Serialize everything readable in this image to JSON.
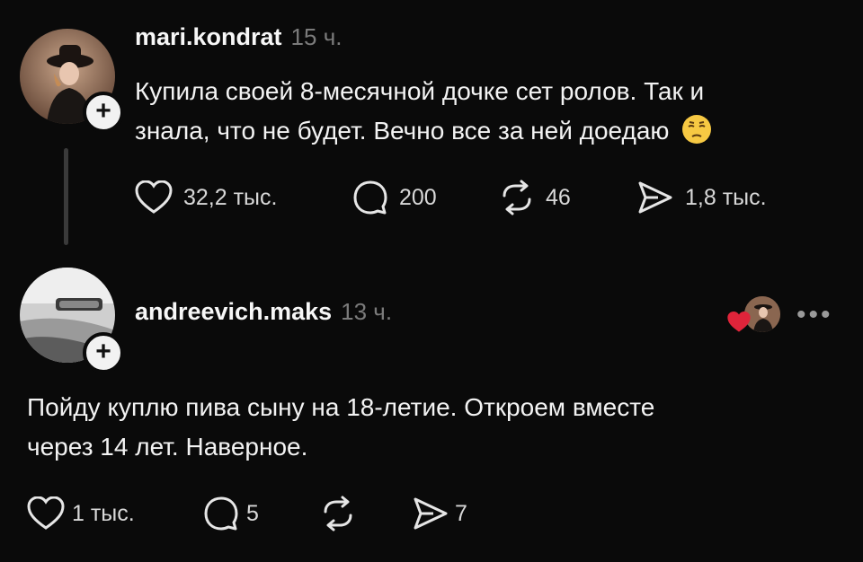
{
  "posts": [
    {
      "username": "mari.kondrat",
      "time": "15 ч.",
      "text_line1": "Купила своей 8-месячной дочке сет ролов. Так и",
      "text_line2": "знала, что не будет. Вечно все за ней доедаю",
      "emoji": "😔",
      "likes": "32,2 тыс.",
      "comments": "200",
      "reposts": "46",
      "shares": "1,8 тыс."
    },
    {
      "username": "andreevich.maks",
      "time": "13 ч.",
      "text_line1": "Пойду куплю пива сыну на 18-летие. Откроем вместе",
      "text_line2": "через 14 лет. Наверное.",
      "likes": "1 тыс.",
      "comments": "5",
      "reposts": "",
      "shares": "7",
      "more": "•••"
    }
  ],
  "icons": {
    "like": "heart-icon",
    "comment": "comment-icon",
    "repost": "repost-icon",
    "share": "share-icon",
    "follow": "plus-icon"
  },
  "colors": {
    "background": "#0a0a0a",
    "text": "#f3f3f3",
    "muted": "#7b7b7b",
    "heart": "#e0243a"
  }
}
